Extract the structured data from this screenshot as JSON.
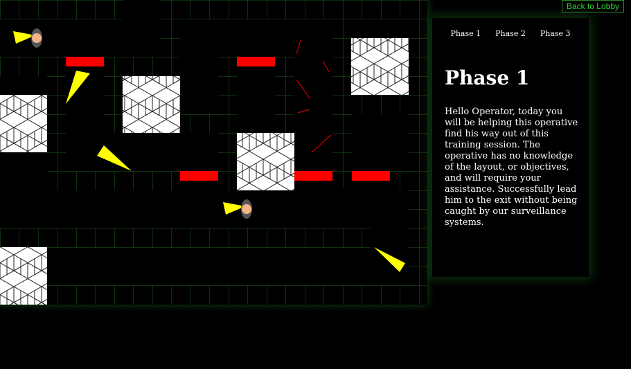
{
  "nav": {
    "back_label": "Back to Lobby"
  },
  "panel": {
    "tabs": [
      "Phase 1",
      "Phase 2",
      "Phase 3"
    ],
    "title": "Phase 1",
    "text": "Hello Operator, today you will be helping this operative find his way out of this training session. The operative has no knowledge of the layout, or objectives, and will require your assistance. Successfully lead him to the exit without being caught by our surveillance systems."
  },
  "colors": {
    "grid_line": "#1f5a1f",
    "door": "#ff0000",
    "camera_cone": "#ffff00",
    "laser": "#cc0000",
    "operative_head": "#f4b48a"
  },
  "entities": {
    "operatives": [
      "operative",
      "operative"
    ],
    "cameras": [
      "camera-cone",
      "camera-cone",
      "camera-cone",
      "camera-cone"
    ],
    "doors": [
      "red-door",
      "red-door",
      "red-door",
      "red-door",
      "red-door"
    ]
  }
}
